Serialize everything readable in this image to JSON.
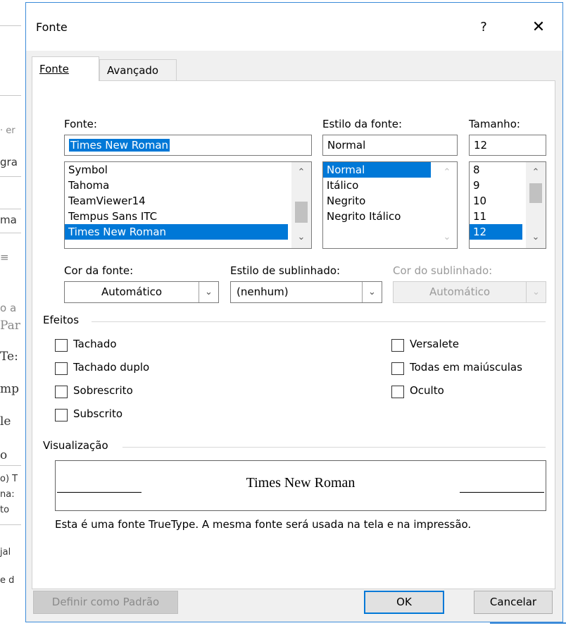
{
  "background_doc": {
    "fragments": [
      "· er",
      "gra",
      "ma",
      "≡",
      "o a",
      "Par",
      "Te:",
      "mp",
      "le",
      "o",
      "o) T",
      "na:",
      "to",
      "jal",
      "e d"
    ]
  },
  "dialog": {
    "title": "Fonte",
    "help_label": "?",
    "close_label": "✕"
  },
  "tabs": [
    {
      "label": "Fonte",
      "active": true
    },
    {
      "label": "Avançado",
      "active": false
    }
  ],
  "font": {
    "label": "Fonte:",
    "value": "Times New Roman",
    "options": [
      "Symbol",
      "Tahoma",
      "TeamViewer14",
      "Tempus Sans ITC",
      "Times New Roman"
    ],
    "selected_index": 4
  },
  "style": {
    "label": "Estilo da fonte:",
    "value": "Normal",
    "options": [
      "Normal",
      "Itálico",
      "Negrito",
      "Negrito Itálico"
    ],
    "selected_index": 0
  },
  "size": {
    "label": "Tamanho:",
    "value": "12",
    "options": [
      "8",
      "9",
      "10",
      "11",
      "12"
    ],
    "selected_index": 4
  },
  "font_color": {
    "label": "Cor da fonte:",
    "value": "Automático"
  },
  "underline_style": {
    "label": "Estilo de sublinhado:",
    "value": "(nenhum)"
  },
  "underline_color": {
    "label": "Cor do sublinhado:",
    "value": "Automático",
    "disabled": true
  },
  "effects": {
    "title": "Efeitos",
    "left": [
      {
        "label": "Tachado",
        "checked": false
      },
      {
        "label": "Tachado duplo",
        "checked": false
      },
      {
        "label": "Sobrescrito",
        "checked": false
      },
      {
        "label": "Subscrito",
        "checked": false
      }
    ],
    "right": [
      {
        "label": "Versalete",
        "checked": false
      },
      {
        "label": "Todas em maiúsculas",
        "checked": false
      },
      {
        "label": "Oculto",
        "checked": false
      }
    ]
  },
  "preview": {
    "title": "Visualização",
    "text": "Times New Roman",
    "note": "Esta é uma fonte TrueType. A mesma fonte será usada na tela e na impressão."
  },
  "buttons": {
    "set_default": "Definir como Padrão",
    "ok": "OK",
    "cancel": "Cancelar"
  }
}
